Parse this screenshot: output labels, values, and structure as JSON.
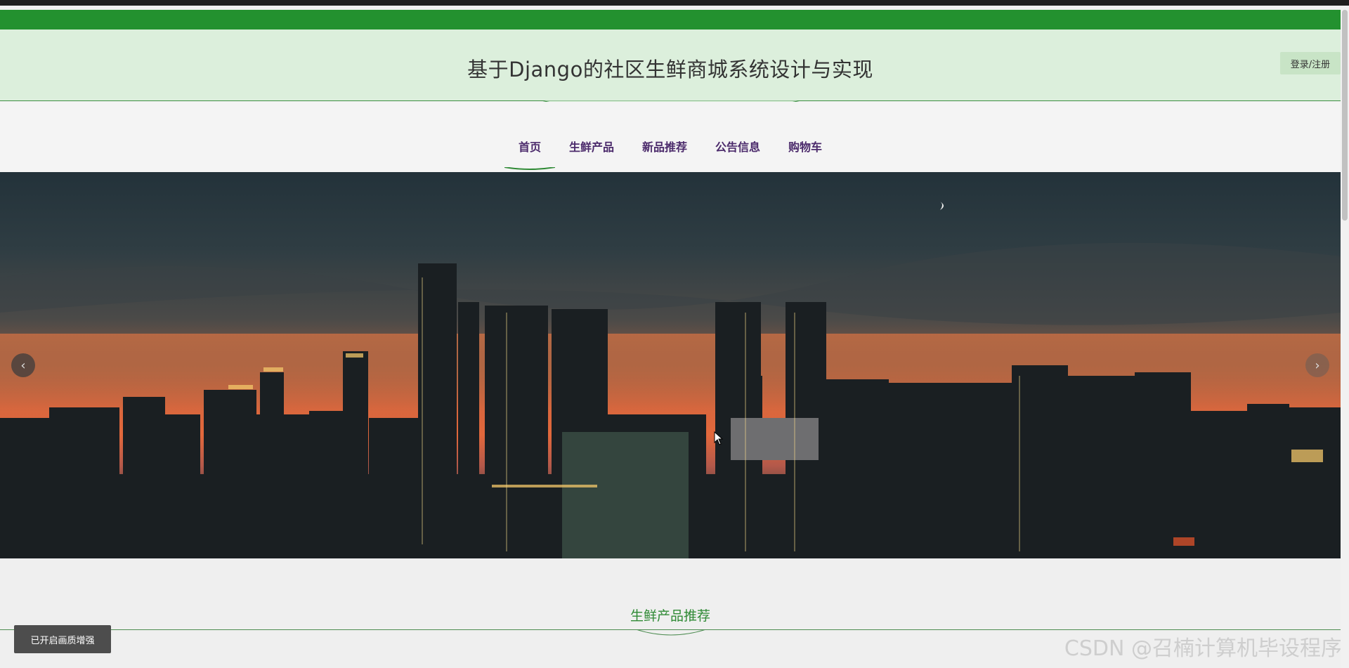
{
  "header": {
    "title": "基于Django的社区生鲜商城系统设计与实现",
    "login_label": "登录/注册"
  },
  "nav": {
    "items": [
      {
        "label": "首页",
        "active": true
      },
      {
        "label": "生鲜产品"
      },
      {
        "label": "新品推荐"
      },
      {
        "label": "公告信息"
      },
      {
        "label": "购物车"
      }
    ]
  },
  "banner": {
    "prev_label": "‹",
    "next_label": "›"
  },
  "section": {
    "title": "生鲜产品推荐"
  },
  "toast": {
    "text": "已开启画质增强"
  },
  "watermark": {
    "text": "CSDN @召楠计算机毕设程序"
  },
  "colors": {
    "brand_green": "#23912f",
    "header_bg": "#dcefdc",
    "nav_text": "#4b2a6b"
  }
}
